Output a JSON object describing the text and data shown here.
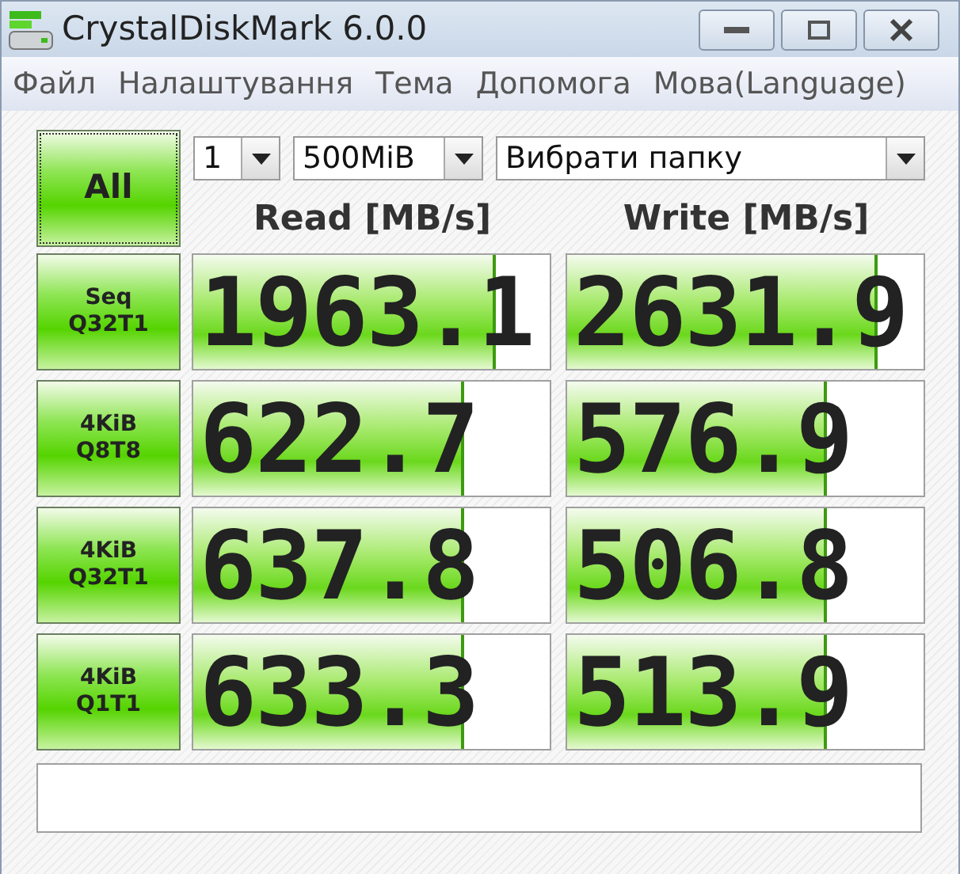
{
  "window": {
    "title": "CrystalDiskMark 6.0.0"
  },
  "menu": [
    "Файл",
    "Налаштування",
    "Тема",
    "Допомога",
    "Мова(Language)"
  ],
  "controls": {
    "all_button": "All",
    "count": "1",
    "size": "500MiB",
    "folder": "Вибрати папку"
  },
  "headers": [
    "Read [MB/s]",
    "Write [MB/s]"
  ],
  "rows": [
    {
      "test": "Seq\nQ32T1",
      "read": {
        "value": "1963.1",
        "level": 0.85
      },
      "write": {
        "value": "2631.9",
        "level": 0.87
      }
    },
    {
      "test": "4KiB\nQ8T8",
      "read": {
        "value": "622.7",
        "level": 0.76
      },
      "write": {
        "value": "576.9",
        "level": 0.73
      }
    },
    {
      "test": "4KiB\nQ32T1",
      "read": {
        "value": "637.8",
        "level": 0.76
      },
      "write": {
        "value": "506.8",
        "level": 0.73
      }
    },
    {
      "test": "4KiB\nQ1T1",
      "read": {
        "value": "633.3",
        "level": 0.76
      },
      "write": {
        "value": "513.9",
        "level": 0.73
      }
    }
  ]
}
